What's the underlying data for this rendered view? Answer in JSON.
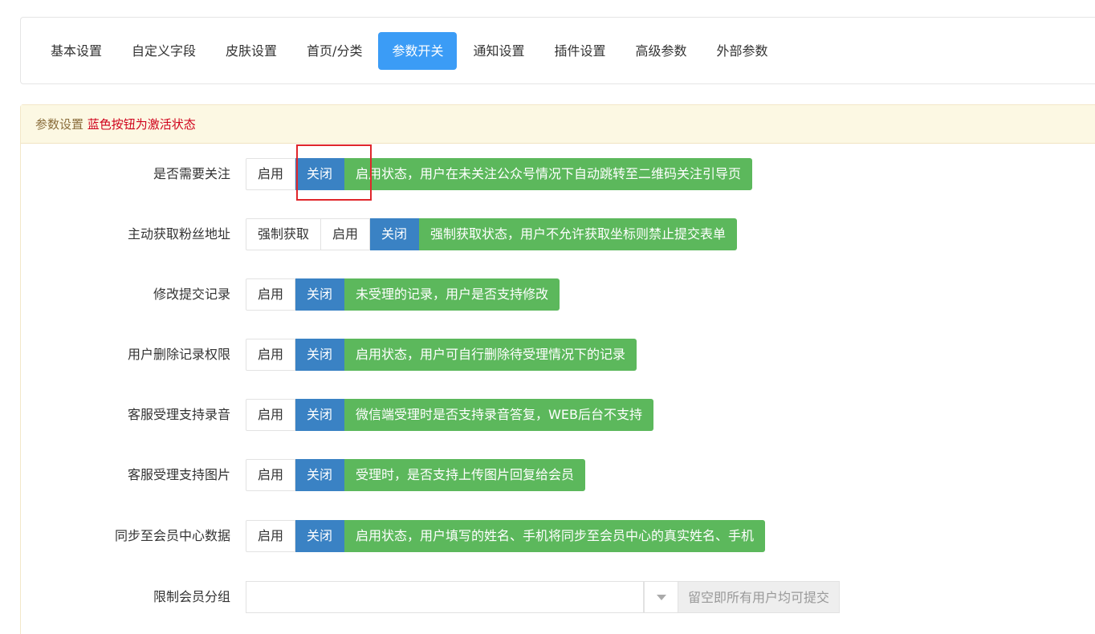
{
  "tabs": [
    {
      "label": "基本设置",
      "active": false
    },
    {
      "label": "自定义字段",
      "active": false
    },
    {
      "label": "皮肤设置",
      "active": false
    },
    {
      "label": "首页/分类",
      "active": false
    },
    {
      "label": "参数开关",
      "active": true
    },
    {
      "label": "通知设置",
      "active": false
    },
    {
      "label": "插件设置",
      "active": false
    },
    {
      "label": "高级参数",
      "active": false
    },
    {
      "label": "外部参数",
      "active": false
    }
  ],
  "panel": {
    "title": "参数设置",
    "hint": "蓝色按钮为激活状态"
  },
  "settings": [
    {
      "label": "是否需要关注",
      "options": [
        "启用",
        "关闭"
      ],
      "active_option": "关闭",
      "note": "启用状态，用户在未关注公众号情况下自动跳转至二维码关注引导页"
    },
    {
      "label": "主动获取粉丝地址",
      "options": [
        "强制获取",
        "启用",
        "关闭"
      ],
      "active_option": "关闭",
      "note": "强制获取状态，用户不允许获取坐标则禁止提交表单"
    },
    {
      "label": "修改提交记录",
      "options": [
        "启用",
        "关闭"
      ],
      "active_option": "关闭",
      "note": "未受理的记录，用户是否支持修改"
    },
    {
      "label": "用户删除记录权限",
      "options": [
        "启用",
        "关闭"
      ],
      "active_option": "关闭",
      "note": "启用状态，用户可自行删除待受理情况下的记录"
    },
    {
      "label": "客服受理支持录音",
      "options": [
        "启用",
        "关闭"
      ],
      "active_option": "关闭",
      "note": "微信端受理时是否支持录音答复，WEB后台不支持"
    },
    {
      "label": "客服受理支持图片",
      "options": [
        "启用",
        "关闭"
      ],
      "active_option": "关闭",
      "note": "受理时，是否支持上传图片回复给会员"
    },
    {
      "label": "同步至会员中心数据",
      "options": [
        "启用",
        "关闭"
      ],
      "active_option": "关闭",
      "note": "启用状态，用户填写的姓名、手机将同步至会员中心的真实姓名、手机"
    }
  ],
  "member_group": {
    "label": "限制会员分组",
    "value": "",
    "addon": "留空即所有用户均可提交"
  },
  "colors": {
    "tab_active": "#3b9cf6",
    "option_active": "#3a82c4",
    "note_bg": "#5cb85c",
    "hint_red": "#d0021b",
    "panel_head_bg": "#fcf8e3"
  }
}
